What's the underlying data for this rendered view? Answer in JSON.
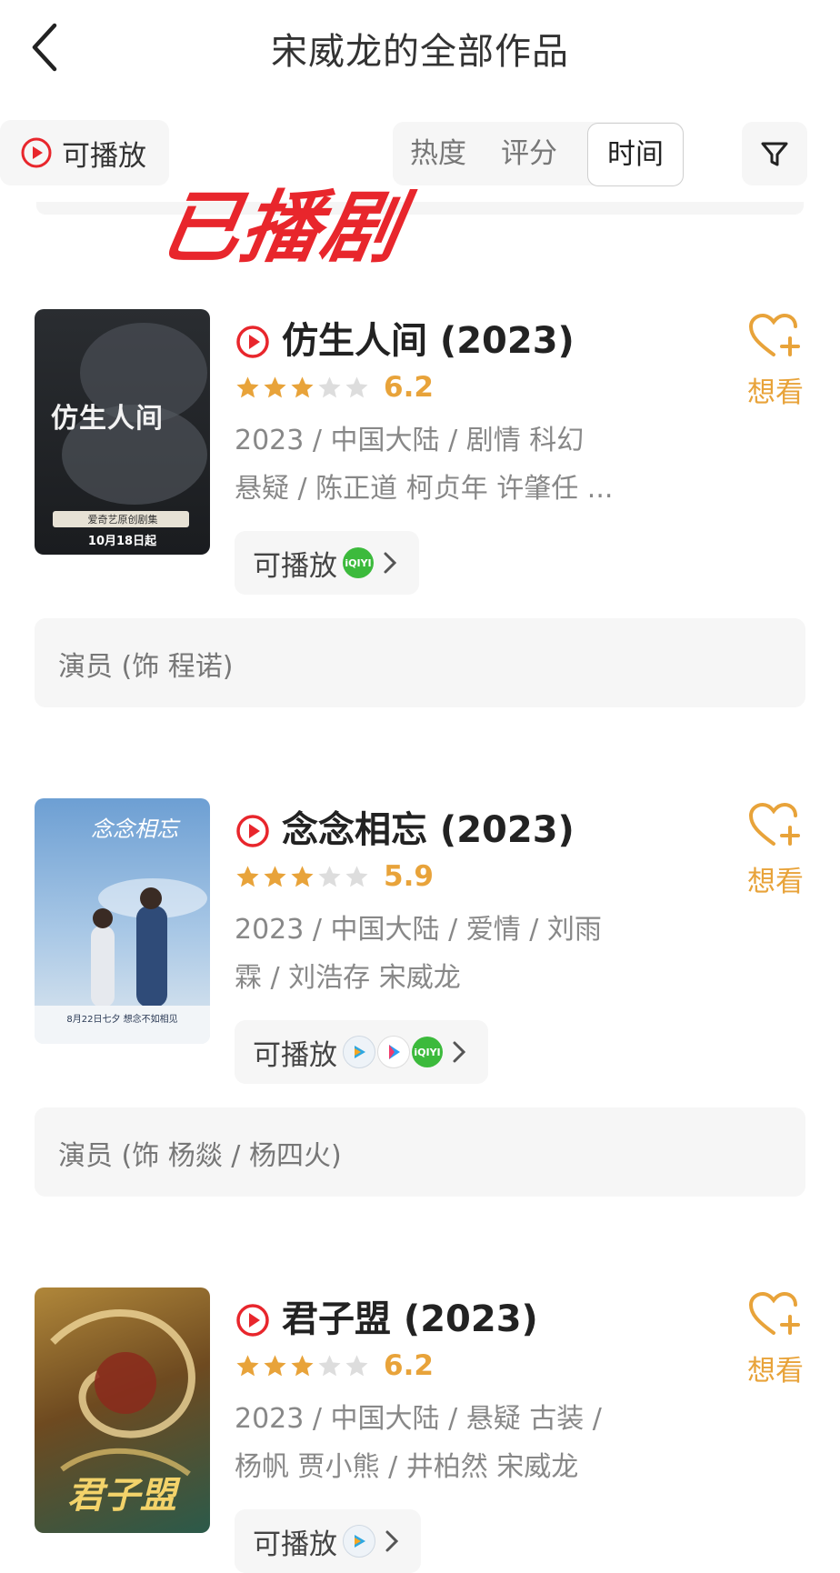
{
  "header": {
    "title": "宋威龙的全部作品"
  },
  "toolbar": {
    "playable_label": "可播放",
    "sort_tabs": [
      "热度",
      "评分",
      "时间"
    ],
    "active_sort": "时间"
  },
  "overlay_stamp": "已播剧",
  "works": [
    {
      "title": "仿生人间 (2023)",
      "rating": 6.2,
      "stars_filled": 3,
      "meta_line1": "2023 / 中国大陆 / 剧情 科幻",
      "meta_line2": "悬疑 / 陈正道 柯贞年 许肇任 ...",
      "playable_label": "可播放",
      "platforms": [
        "iqiyi-icon"
      ],
      "want_label": "想看",
      "role": "演员 (饰 程诺)",
      "poster": {
        "title_text": "仿生人间",
        "date_text": "10月18日起",
        "tag_text": "爱奇艺原创剧集",
        "colors": [
          "#1d1f22",
          "#3a3e43"
        ]
      }
    },
    {
      "title": "念念相忘 (2023)",
      "rating": 5.9,
      "stars_filled": 3,
      "meta_line1": "2023 / 中国大陆 / 爱情 / 刘雨",
      "meta_line2": "霖 / 刘浩存 宋威龙",
      "playable_label": "可播放",
      "platforms": [
        "tencent-video-icon",
        "youku-icon",
        "iqiyi-icon"
      ],
      "want_label": "想看",
      "role": "演员 (饰 杨燚 / 杨四火)",
      "poster": {
        "title_text": "念念相忘",
        "date_text": "8月22日七夕 想念不如相见",
        "colors": [
          "#6d9fd3",
          "#b9d4ec"
        ]
      }
    },
    {
      "title": "君子盟 (2023)",
      "rating": 6.2,
      "stars_filled": 3,
      "meta_line1": "2023 / 中国大陆 / 悬疑 古装 /",
      "meta_line2": "杨帆 贾小熊 / 井柏然 宋威龙",
      "playable_label": "可播放",
      "platforms": [
        "tencent-video-icon"
      ],
      "want_label": "想看",
      "poster": {
        "title_text": "君子盟",
        "colors": [
          "#8a6a2a",
          "#2b5a4a"
        ]
      }
    }
  ],
  "colors": {
    "accent_red": "#e8262c",
    "rating_gold": "#e8a33a",
    "star_empty": "#dddddd",
    "iqiyi_green": "#3cba3c"
  }
}
